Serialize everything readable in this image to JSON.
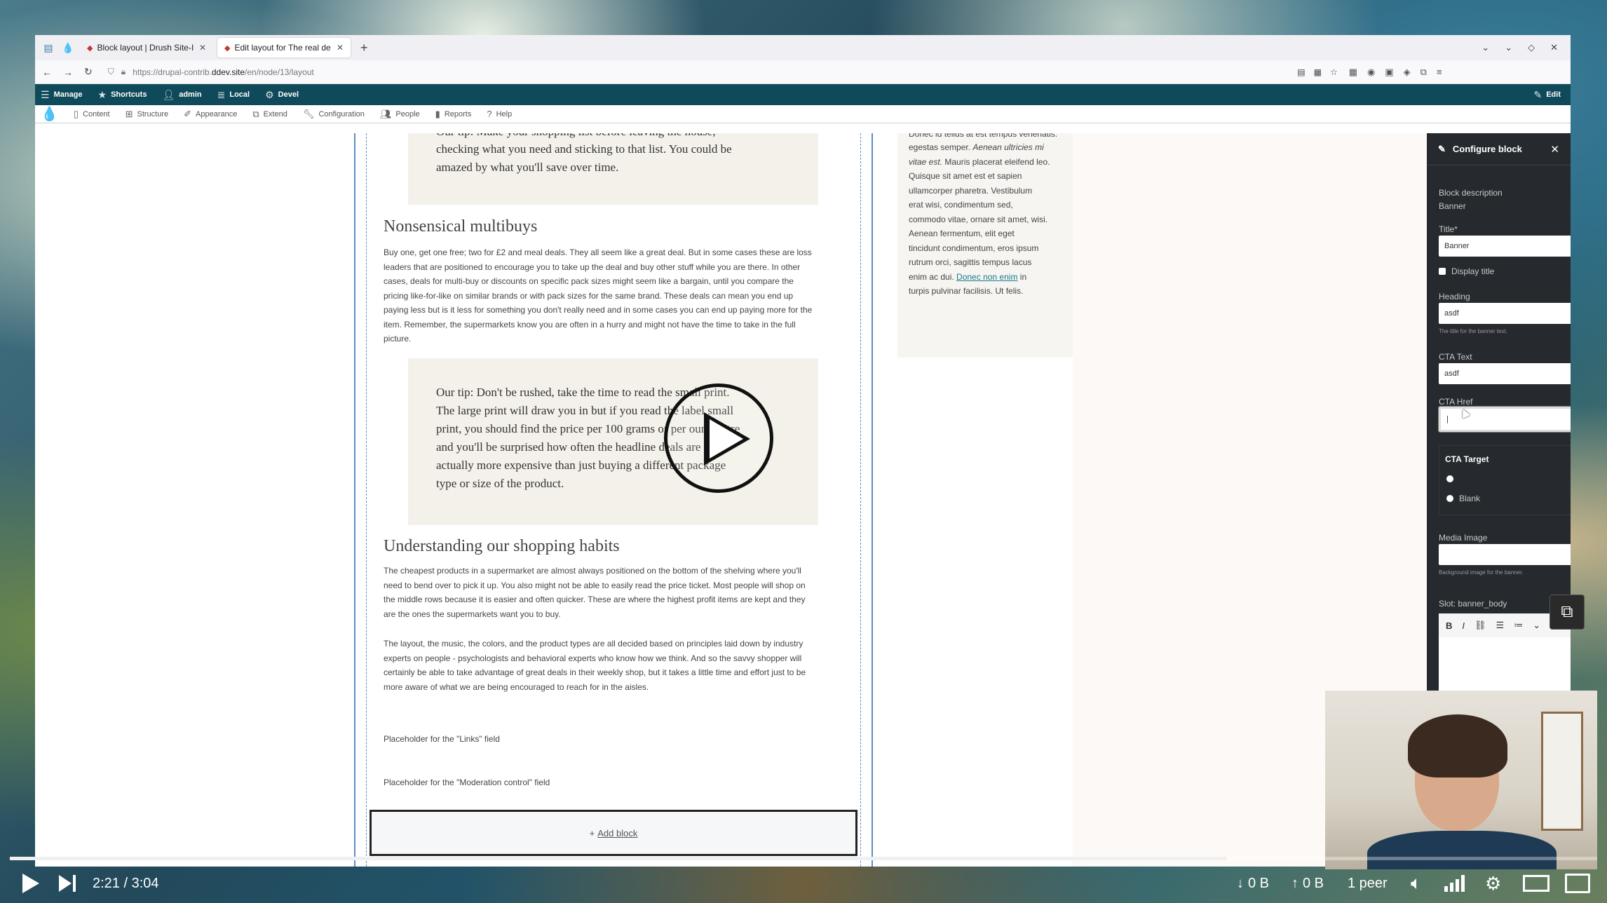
{
  "browser": {
    "tabs": [
      {
        "label": "Block layout | Drush Site-I"
      },
      {
        "label": "Edit layout for The real de"
      }
    ],
    "url": {
      "prefix": "https://drupal-contrib.",
      "domain": "ddev.site",
      "path": "/en/node/13/layout"
    }
  },
  "toolbar": {
    "main": {
      "manage": "Manage",
      "shortcuts": "Shortcuts",
      "admin": "admin",
      "local": "Local",
      "devel": "Devel",
      "edit": "Edit"
    },
    "tray": {
      "content": "Content",
      "structure": "Structure",
      "appearance": "Appearance",
      "extend": "Extend",
      "configuration": "Configuration",
      "people": "People",
      "reports": "Reports",
      "help": "Help"
    }
  },
  "article": {
    "tip1_top": "Our tip: Make your shopping list before leaving the house,",
    "tip1_l2": "checking what you need and sticking to that list. You could be",
    "tip1_l3": "amazed by what you'll save over time.",
    "heading1": "Nonsensical multibuys",
    "para1": [
      "Buy one, get one free; two for £2 and meal deals. They all seem like a great deal. But in some cases these are loss",
      "leaders that are positioned to encourage you to take up the deal and buy other stuff while you are there. In other",
      "cases, deals for multi-buy or discounts on specific pack sizes might seem like a bargain, until you compare the",
      "pricing like-for-like on similar brands or with pack sizes for the same brand. These deals can mean you end up",
      "paying less but is it less for something you don't really need and in some cases you can end up paying more for the",
      "item. Remember, the supermarkets know you are often in a hurry and might not have the time to take in the full",
      "picture."
    ],
    "tip2": [
      "Our tip: Don't be rushed, take the time to read the small print.",
      "The large print will draw you in but if you read the label small",
      "print, you should find the price per 100 grams or per ounce/litre",
      "and you'll be surprised how often the headline deals are",
      "actually more expensive than just buying a different package",
      "type or size of the product."
    ],
    "heading2": "Understanding our shopping habits",
    "para2": [
      "The cheapest products in a supermarket are almost always positioned on the bottom of the shelving where you'll",
      "need to bend over to pick it up. You also might not be able to easily read the price ticket. Most people will shop on",
      "the middle rows because it is easier and often quicker. These are where the highest profit items are kept and they",
      "are the ones the supermarkets want you to buy."
    ],
    "para3": [
      "The layout, the music, the colors, and the product types are all decided based on principles laid down by industry",
      "experts on people - psychologists and behavioral experts who know how we think. And so the savvy shopper will",
      "certainly be able to take advantage of great deals in their weekly shop, but it takes a little time and effort just to be",
      "more aware of what we are being encouraged to reach for in the aisles."
    ],
    "placeholder_links": "Placeholder for the \"Links\" field",
    "placeholder_moderation": "Placeholder for the \"Moderation control\" field",
    "add_block": "Add block"
  },
  "sidebar": {
    "lines": [
      "Donec id tellus at est tempus venenatis.",
      "egestas semper.",
      "vitae est.",
      "Quisque sit amet est et sapien",
      "ullamcorper pharetra. Vestibulum",
      "erat wisi, condimentum sed,",
      "commodo vitae, ornare sit amet, wisi.",
      "Aenean fermentum, elit eget",
      "tincidunt condimentum, eros ipsum",
      "rutrum orci, sagittis tempus lacus",
      "enim ac dui.",
      "in",
      "turpis pulvinar facilisis. Ut felis."
    ],
    "em1": "Aenean ultricies mi",
    "em2_suffix": "Mauris placerat eleifend leo.",
    "link": "Donec non enim"
  },
  "panel": {
    "title": "Configure block",
    "block_description_label": "Block description",
    "block_description_value": "Banner",
    "title_label": "Title*",
    "title_value": "Banner",
    "display_title": "Display title",
    "heading_label": "Heading",
    "heading_value": "asdf",
    "heading_desc": "The title for the banner text.",
    "cta_text_label": "CTA Text",
    "cta_text_value": "asdf",
    "cta_href_label": "CTA Href",
    "cta_href_value": "|",
    "cta_target_label": "CTA Target",
    "cta_target_option": "Blank",
    "media_image_label": "Media Image",
    "media_image_desc": "Background image for the banner.",
    "slot_label": "Slot: banner_body"
  },
  "video": {
    "time": "2:21 / 3:04",
    "progress_fraction": 0.7663,
    "down": "0 B",
    "up": "0 B",
    "peers": "1 peer"
  },
  "colors": {
    "toolbar": "#0f4a5a",
    "panel": "#262a2e",
    "region_border": "#5c8dc2",
    "link": "#1a7d8c"
  }
}
